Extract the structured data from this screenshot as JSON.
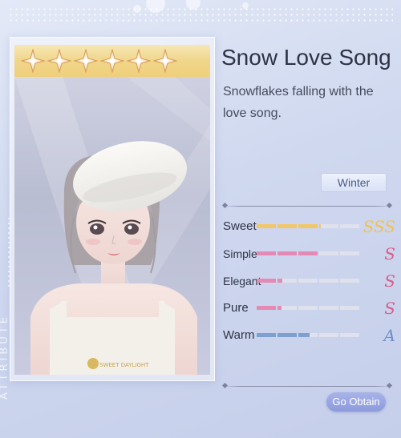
{
  "outfit": {
    "title": "Snow Love Song",
    "description": "Snowflakes falling with the love song.",
    "star_count": 6,
    "tag": "Winter",
    "side_label": "ATTRIBUTE"
  },
  "badge_text": "SWEET DAYLIGHT",
  "stats": [
    {
      "name": "Sweet",
      "grade": "SSS",
      "fill": 0.62,
      "color": "#f3c766",
      "grade_color": "#f2c14e"
    },
    {
      "name": "Simple",
      "grade": "S",
      "fill": 0.6,
      "color": "#e58ab4",
      "grade_color": "#d85e8e"
    },
    {
      "name": "Elegant",
      "grade": "S",
      "fill": 0.25,
      "color": "#e58ab4",
      "grade_color": "#d85e8e"
    },
    {
      "name": "Pure",
      "grade": "S",
      "fill": 0.24,
      "color": "#e58ab4",
      "grade_color": "#d85e8e"
    },
    {
      "name": "Warm",
      "grade": "A",
      "fill": 0.52,
      "color": "#7f9fd0",
      "grade_color": "#6d8fcc"
    }
  ],
  "actions": {
    "obtain_label": "Go Obtain"
  },
  "colors": {
    "title": "#2e3346",
    "button": "#8d9bdc",
    "stars_bar": "#f0d68a"
  }
}
